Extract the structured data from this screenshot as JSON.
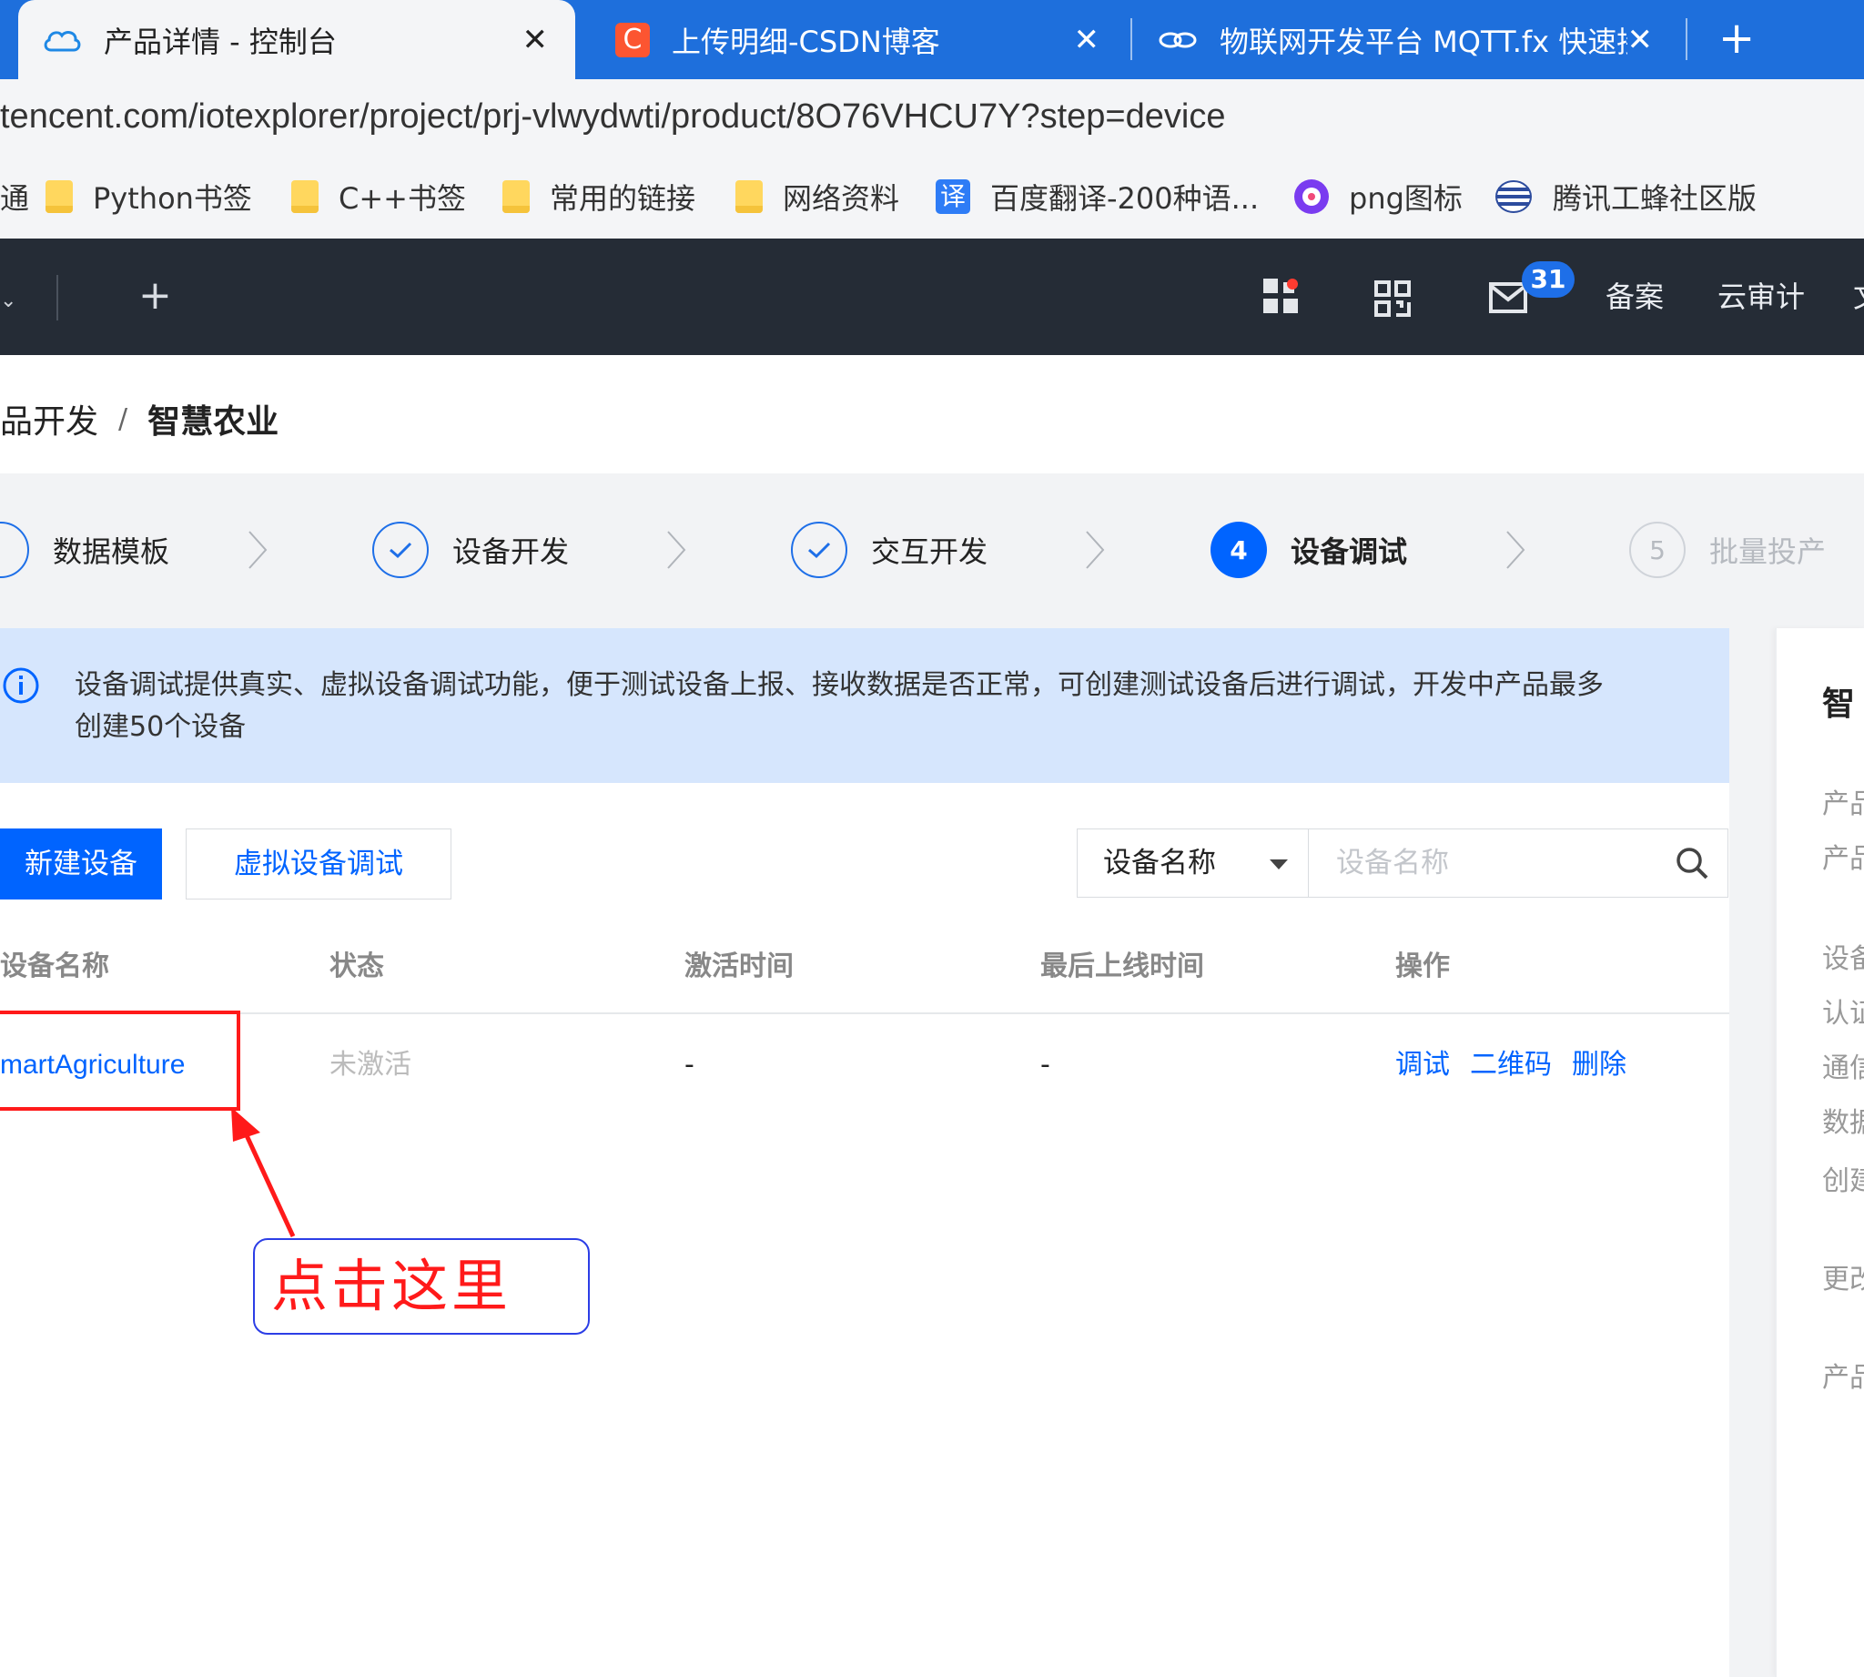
{
  "browser": {
    "tabs": [
      {
        "title": "产品详情 - 控制台",
        "close": "✕",
        "active": true
      },
      {
        "title": "上传明细-CSDN博客",
        "close": "✕",
        "active": false,
        "icon_letter": "C"
      },
      {
        "title": "物联网开发平台 MQTT.fx 快速接",
        "close": "✕",
        "active": false
      }
    ],
    "new_tab": "+",
    "url": "tencent.com/iotexplorer/project/prj-vlwydwti/product/8O76VHCU7Y?step=device",
    "bookmarks": [
      {
        "label": "Python书签",
        "icon": "folder-icon"
      },
      {
        "label": "C++书签",
        "icon": "folder-icon"
      },
      {
        "label": "常用的链接",
        "icon": "folder-icon"
      },
      {
        "label": "网络资料",
        "icon": "folder-icon"
      },
      {
        "label": "百度翻译-200种语...",
        "icon": "translate-icon",
        "icon_text": "译"
      },
      {
        "label": "png图标",
        "icon": "png-icon"
      },
      {
        "label": "腾讯工蜂社区版",
        "icon": "gongfeng-icon"
      }
    ],
    "bookmark_partial": "通"
  },
  "topnav": {
    "plus": "+",
    "mail_count": "31",
    "items": [
      "备案",
      "云审计"
    ],
    "partial": "文"
  },
  "breadcrumb": {
    "parent": "品开发",
    "separator": "/",
    "current": "智慧农业"
  },
  "steps": [
    {
      "label": "数据模板",
      "state": "done"
    },
    {
      "label": "设备开发",
      "state": "done"
    },
    {
      "label": "交互开发",
      "state": "done"
    },
    {
      "label": "设备调试",
      "state": "active",
      "number": "4"
    },
    {
      "label": "批量投产",
      "state": "todo",
      "number": "5"
    }
  ],
  "info": {
    "text": "设备调试提供真实、虚拟设备调试功能，便于测试设备上报、接收数据是否正常，可创建测试设备后进行调试，开发中产品最多创建50个设备"
  },
  "toolbar": {
    "new_device": "新建设备",
    "virtual_debug": "虚拟设备调试",
    "filter_select": "设备名称",
    "search_placeholder": "设备名称"
  },
  "table": {
    "headers": [
      "设备名称",
      "状态",
      "激活时间",
      "最后上线时间",
      "操作"
    ],
    "rows": [
      {
        "name": "martAgriculture",
        "status": "未激活",
        "activated": "-",
        "last_online": "-",
        "actions": [
          "调试",
          "二维码",
          "删除"
        ]
      }
    ]
  },
  "annotation": {
    "callout": "点击这里"
  },
  "right_panel": {
    "title": "智",
    "items": [
      "产品",
      "产品",
      "设备",
      "认证",
      "通信",
      "数据",
      "创建",
      "更改",
      "产品"
    ]
  },
  "colors": {
    "tabbar": "#1e6fdc",
    "nav_dark": "#252c36",
    "primary": "#0064ff",
    "info_bg": "#d6e6fd",
    "annotation_red": "#ff1a1a"
  }
}
